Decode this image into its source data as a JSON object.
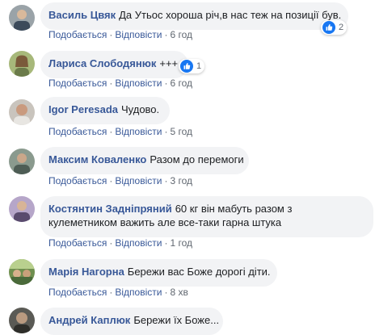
{
  "actions": {
    "like_label": "Подобається",
    "reply_label": "Відповісти",
    "separator": "·"
  },
  "comments": [
    {
      "author": "Василь Цвяк",
      "text": "Да Утьос хороша річ,в нас теж на позиції був.",
      "time": "6 год",
      "reactions": "2"
    },
    {
      "author": "Лариса Слободянюк",
      "text": "+++",
      "time": "6 год",
      "reactions": "1"
    },
    {
      "author": "Igor Peresada",
      "text": "Чудово.",
      "time": "5 год"
    },
    {
      "author": "Максим Коваленко",
      "text": "Разом до перемоги",
      "time": "3 год"
    },
    {
      "author": "Костянтин Задніпряний",
      "text": "60 кг він мабуть разом з кулеметником важить але все-таки гарна штука",
      "time": "1 год"
    },
    {
      "author": "Марія Нагорна",
      "text": "Бережи вас Боже дорогі діти.",
      "time": "8 хв"
    },
    {
      "author": "Андрей Каплюк",
      "text": "Бережи їх Боже...",
      "time": ""
    }
  ],
  "icons": {
    "like_reaction": "thumbs-up-icon"
  },
  "colors": {
    "author": "#385898",
    "bubble": "#f2f3f5",
    "meta": "#606770",
    "like_blue": "#1877f2"
  }
}
